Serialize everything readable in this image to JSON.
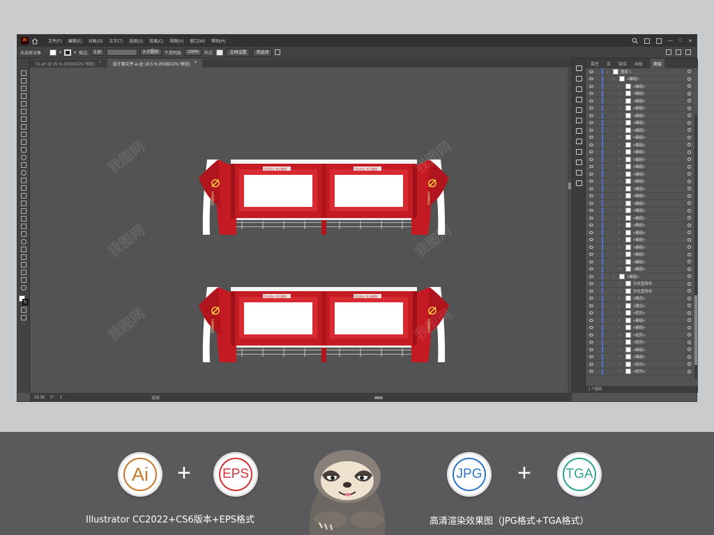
{
  "colors": {
    "app_bg": "#535353",
    "accent_red": "#c41a24",
    "ai_orange": "#c9782c",
    "eps_red": "#d6323a",
    "jpg_blue": "#2f76c9",
    "tga_green": "#2fa68e",
    "layer_blue": "#4f73d8"
  },
  "app": {
    "logo": "Ai",
    "menu": [
      "文件(F)",
      "编辑(E)",
      "对象(O)",
      "文字(T)",
      "选择(S)",
      "效果(C)",
      "视图(V)",
      "窗口(W)",
      "帮助(H)"
    ]
  },
  "control": {
    "no_selection": "未选择对象",
    "stroke_label": "描边:",
    "stroke_value": "1 pt",
    "brush_value": "3 点圆形",
    "opacity_label": "不透明度:",
    "opacity_value": "100%",
    "style_label": "样式:",
    "doc_setup": "文档设置",
    "preferences": "首选项"
  },
  "tabs": [
    {
      "label": "01.ai* @ 25 % (RGB/CPU 预览)",
      "close": "×"
    },
    {
      "label": "设计源文件.ai @ 18.5 % (RGB/CPU 预览)",
      "close": "×"
    }
  ],
  "artwork": {
    "banner_text": "不忘初心 牢记使命",
    "side_text": "文化宣传栏"
  },
  "layers_panel": {
    "tabs": [
      "属性",
      "库",
      "链接",
      "画板",
      "图层"
    ],
    "active_tab": "图层",
    "rows": [
      {
        "name": "图层 1",
        "depth": 0
      },
      {
        "name": "<编组>",
        "depth": 1
      },
      {
        "name": "<编组>",
        "depth": 2
      },
      {
        "name": "<编组>",
        "depth": 2
      },
      {
        "name": "<编组>",
        "depth": 2
      },
      {
        "name": "<编组>",
        "depth": 2
      },
      {
        "name": "<编组>",
        "depth": 2
      },
      {
        "name": "<编组>",
        "depth": 2
      },
      {
        "name": "<编组>",
        "depth": 2
      },
      {
        "name": "<编组>",
        "depth": 2
      },
      {
        "name": "<编组>",
        "depth": 2
      },
      {
        "name": "<编组>",
        "depth": 2
      },
      {
        "name": "<编组>",
        "depth": 2
      },
      {
        "name": "<编组>",
        "depth": 2
      },
      {
        "name": "<编组>",
        "depth": 2
      },
      {
        "name": "<编组>",
        "depth": 2
      },
      {
        "name": "<编组>",
        "depth": 2
      },
      {
        "name": "<编组>",
        "depth": 2
      },
      {
        "name": "<编组>",
        "depth": 2
      },
      {
        "name": "<编组>",
        "depth": 2
      },
      {
        "name": "<编组>",
        "depth": 2
      },
      {
        "name": "<编组>",
        "depth": 2
      },
      {
        "name": "<编组>",
        "depth": 2
      },
      {
        "name": "<编组>",
        "depth": 2
      },
      {
        "name": "<编组>",
        "depth": 2
      },
      {
        "name": "<编组>",
        "depth": 2
      },
      {
        "name": "<编组>",
        "depth": 2
      },
      {
        "name": "<编组>",
        "depth": 2
      },
      {
        "name": "<编组>",
        "depth": 1
      },
      {
        "name": "文化宣传栏",
        "depth": 2
      },
      {
        "name": "文化宣传栏",
        "depth": 2
      },
      {
        "name": "<路径>",
        "depth": 2
      },
      {
        "name": "<路径>",
        "depth": 2
      },
      {
        "name": "<矩形>",
        "depth": 2
      },
      {
        "name": "<编组>",
        "depth": 2
      },
      {
        "name": "<编组>",
        "depth": 2
      },
      {
        "name": "<矩形>",
        "depth": 2
      },
      {
        "name": "<矩形>",
        "depth": 2
      },
      {
        "name": "<编组>",
        "depth": 2
      },
      {
        "name": "<编组>",
        "depth": 2
      },
      {
        "name": "<矩形>",
        "depth": 2
      },
      {
        "name": "<矩形>",
        "depth": 2
      }
    ],
    "footer": "1 个图层"
  },
  "status": {
    "zoom": "18.36",
    "angle": "0°",
    "page": "1",
    "tool": "选择"
  },
  "bottom": {
    "ai_label": "Ai",
    "eps_label": "EPS",
    "jpg_label": "JPG",
    "tga_label": "TGA",
    "plus": "+",
    "caption_left": "Illustrator CC2022+CS6版本+EPS格式",
    "caption_right": "高清渲染效果图（JPG格式+TGA格式）"
  },
  "watermark_text": "我图网"
}
